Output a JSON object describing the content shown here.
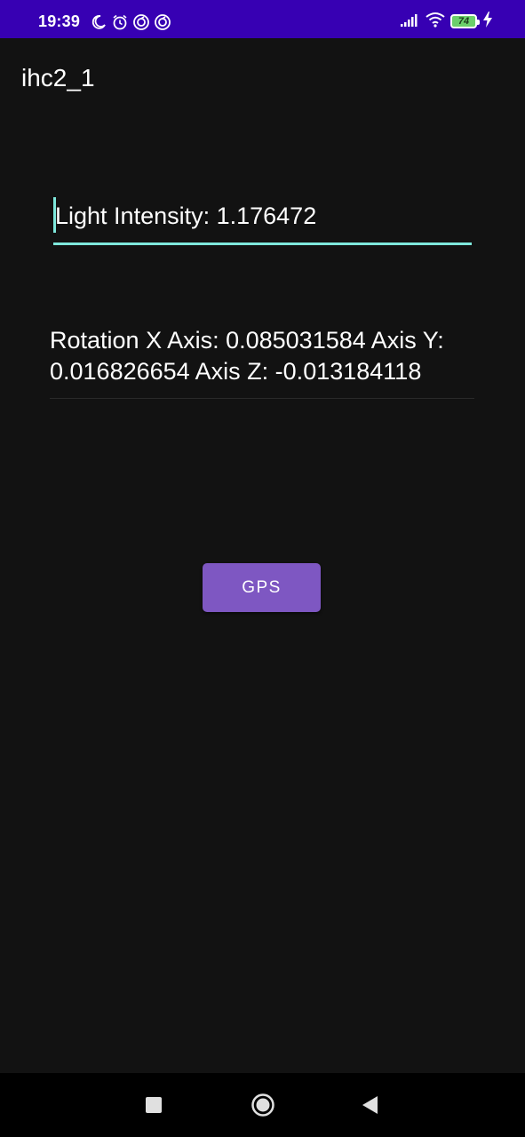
{
  "status_bar": {
    "time": "19:39",
    "battery_level": "74",
    "left_icons": [
      "moon-icon",
      "alarm-icon",
      "vpn-icon",
      "vpn-icon"
    ],
    "right_icons": [
      "signal-icon",
      "wifi-icon",
      "battery-icon",
      "charging-icon"
    ],
    "background_color": "#3700B3"
  },
  "app_bar": {
    "title": "ihc2_1"
  },
  "main": {
    "light_intensity_text": "Light Intensity: 1.176472",
    "rotation_text": "Rotation X Axis: 0.085031584 Axis Y: 0.016826654 Axis Z: -0.013184118",
    "gps_button_label": "GPS"
  },
  "navigation_bar": {
    "buttons": [
      "recents-button",
      "home-button",
      "back-button"
    ]
  },
  "colors": {
    "background": "#121212",
    "accent": "#7ee8dc",
    "button": "#7E57C2"
  }
}
